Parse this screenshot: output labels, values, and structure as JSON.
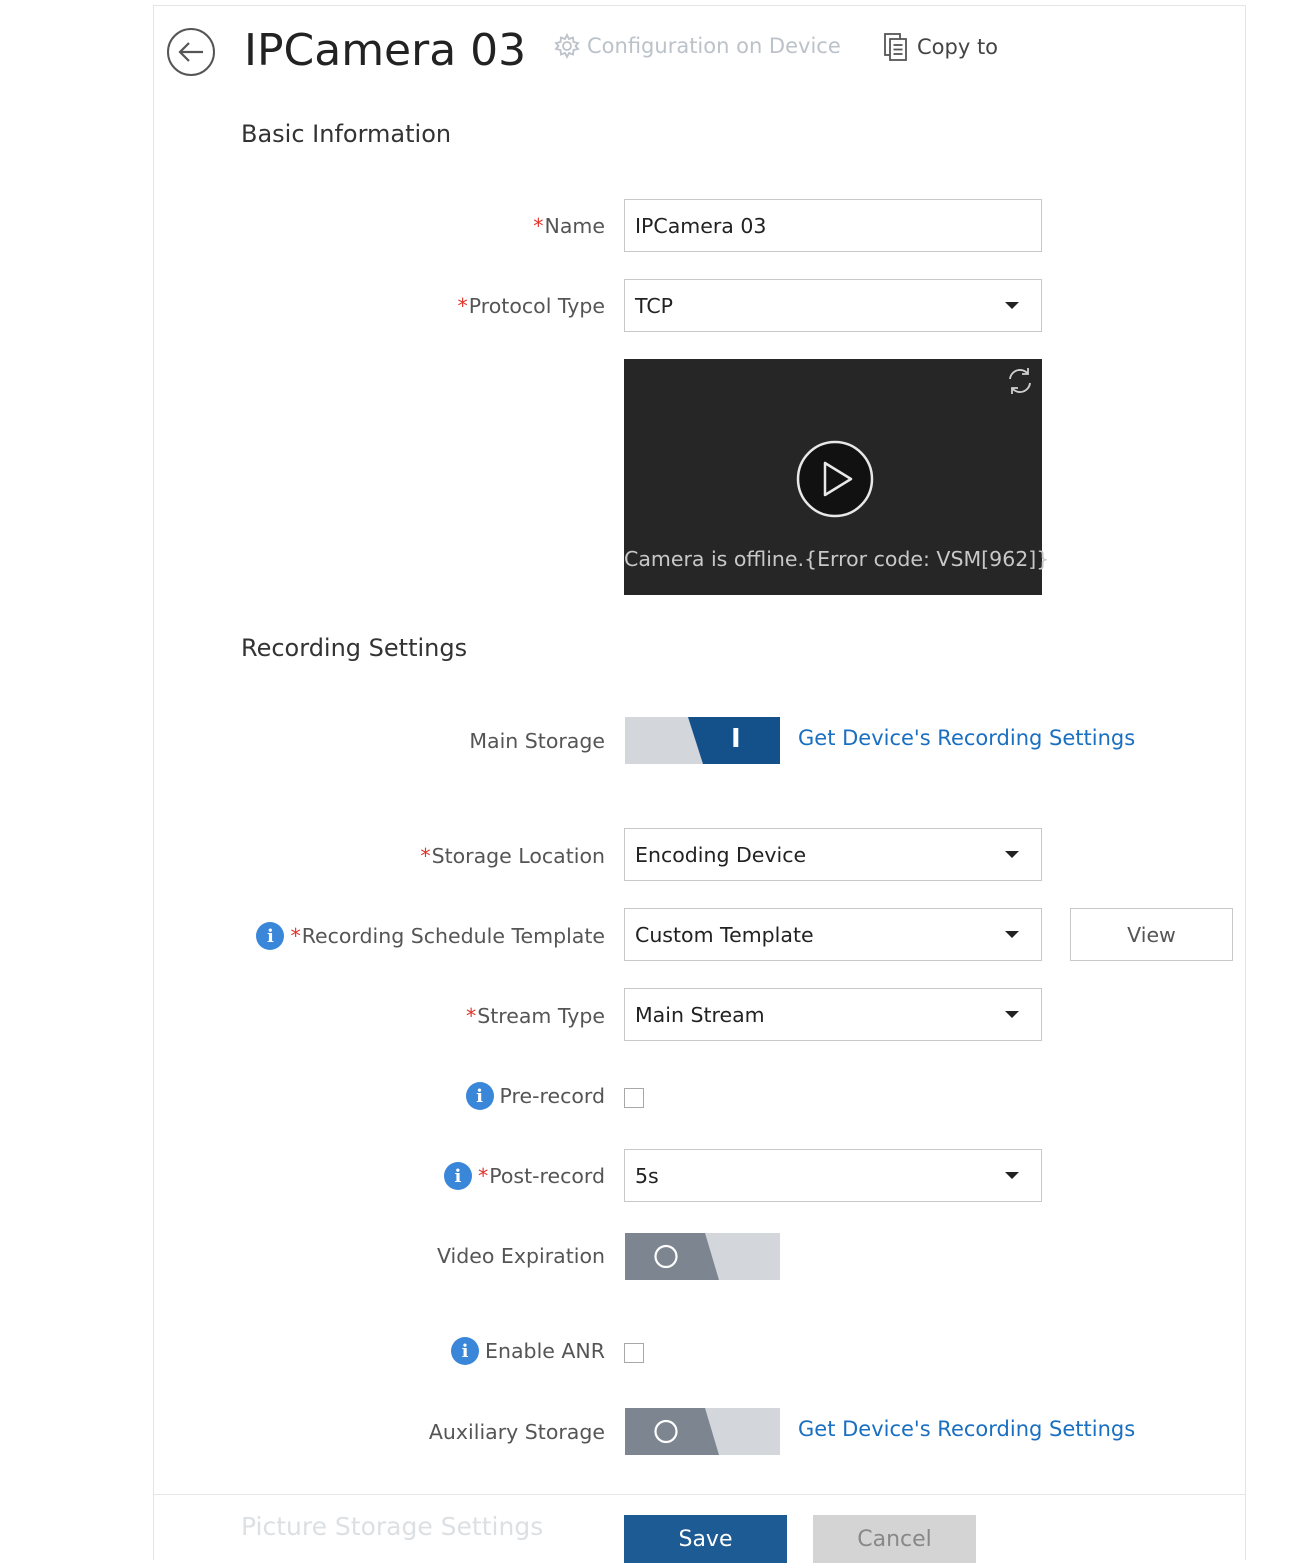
{
  "header": {
    "title": "IPCamera 03",
    "configuration_link": "Configuration on Device",
    "copy_to": "Copy to"
  },
  "basic_info": {
    "section_title": "Basic Information",
    "name_label": "Name",
    "name_value": "IPCamera 03",
    "protocol_label": "Protocol Type",
    "protocol_value": "TCP",
    "preview_message": "Camera is offline.{Error code: VSM[962]}"
  },
  "recording": {
    "section_title": "Recording Settings",
    "main_storage_label": "Main Storage",
    "main_storage_on": true,
    "main_storage_toggle_glyph": "I",
    "get_settings_link": "Get Device's Recording Settings",
    "storage_location_label": "Storage Location",
    "storage_location_value": "Encoding Device",
    "schedule_label": "Recording Schedule Template",
    "schedule_value": "Custom Template",
    "view_button": "View",
    "stream_type_label": "Stream Type",
    "stream_type_value": "Main Stream",
    "pre_record_label": "Pre-record",
    "pre_record_checked": false,
    "post_record_label": "Post-record",
    "post_record_value": "5s",
    "video_expiration_label": "Video Expiration",
    "video_expiration_on": false,
    "enable_anr_label": "Enable ANR",
    "enable_anr_checked": false,
    "aux_storage_label": "Auxiliary Storage",
    "aux_storage_on": false,
    "aux_get_settings_link": "Get Device's Recording Settings"
  },
  "required_marker": "*",
  "info_glyph": "i",
  "footer": {
    "next_section_title": "Picture Storage Settings",
    "save": "Save",
    "cancel": "Cancel"
  },
  "colors": {
    "accent": "#1d5b95",
    "link": "#1a6fc0",
    "required": "#e0342b",
    "info": "#3a86d9",
    "toggle_off": "#7d8590"
  }
}
